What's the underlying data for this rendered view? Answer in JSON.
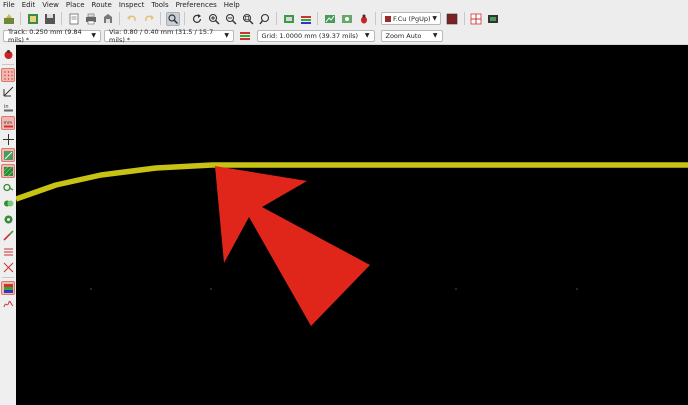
{
  "menu": [
    "File",
    "Edit",
    "View",
    "Place",
    "Route",
    "Inspect",
    "Tools",
    "Preferences",
    "Help"
  ],
  "toolbar": {
    "layer_selector": "F.Cu (PgUp)",
    "icons": [
      "board-setup-icon",
      "library-icon",
      "save-icon",
      "page-settings-icon",
      "print-icon",
      "plot-icon",
      "undo-icon",
      "redo-icon",
      "find-icon",
      "refresh-icon",
      "zoom-in-icon",
      "zoom-out-icon",
      "zoom-fit-icon",
      "zoom-selection-icon",
      "netlist-icon",
      "update-pcb-icon",
      "drc-icon",
      "bug-icon",
      "layer-pair-icon",
      "scripting-icon",
      "3d-viewer-icon"
    ]
  },
  "options": {
    "track": "Track: 0.250 mm (9.84 mils) *",
    "via": "Via: 0.80 / 0.40 mm (31.5 / 15.7 mils) *",
    "grid": "Grid: 1.0000 mm (39.37 mils)",
    "zoom": "Zoom Auto"
  },
  "colors": {
    "canvas_background": "#000000",
    "track_color": "#c8c214",
    "annotation_arrow": "#e0261a",
    "layer_swatch": "#9c2a2a"
  }
}
